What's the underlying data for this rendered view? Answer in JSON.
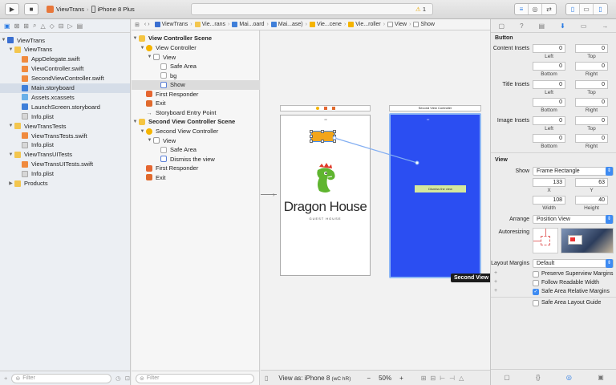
{
  "toolbar": {
    "scheme_target": "ViewTrans",
    "device": "iPhone 8 Plus",
    "warning_count": "1"
  },
  "navigator": {
    "filter_placeholder": "Filter",
    "items": [
      {
        "label": "ViewTrans",
        "type": "project",
        "level": 0
      },
      {
        "label": "ViewTrans",
        "type": "folder",
        "level": 1
      },
      {
        "label": "AppDelegate.swift",
        "type": "swift",
        "level": 2
      },
      {
        "label": "ViewController.swift",
        "type": "swift",
        "level": 2
      },
      {
        "label": "SecondViewController.swift",
        "type": "swift",
        "level": 2
      },
      {
        "label": "Main.storyboard",
        "type": "storyboard",
        "level": 2
      },
      {
        "label": "Assets.xcassets",
        "type": "assets",
        "level": 2
      },
      {
        "label": "LaunchScreen.storyboard",
        "type": "storyboard",
        "level": 2
      },
      {
        "label": "Info.plist",
        "type": "plist",
        "level": 2
      },
      {
        "label": "ViewTransTests",
        "type": "folder",
        "level": 1
      },
      {
        "label": "ViewTransTests.swift",
        "type": "swift",
        "level": 2
      },
      {
        "label": "Info.plist",
        "type": "plist",
        "level": 2
      },
      {
        "label": "ViewTransUITests",
        "type": "folder",
        "level": 1
      },
      {
        "label": "ViewTransUITests.swift",
        "type": "swift",
        "level": 2
      },
      {
        "label": "Info.plist",
        "type": "plist",
        "level": 2
      },
      {
        "label": "Products",
        "type": "folder",
        "level": 1
      }
    ]
  },
  "jumpbar": {
    "crumbs": [
      "ViewTrans",
      "Vie...rans",
      "Mai...oard",
      "Mai...ase)",
      "Vie...cene",
      "Vie...roller",
      "View",
      "Show"
    ]
  },
  "outline": {
    "filter_placeholder": "Filter",
    "scene1": {
      "title": "View Controller Scene",
      "controller": "View Controller",
      "view": "View",
      "safe_area": "Safe Area",
      "bg": "bg",
      "show": "Show",
      "first_responder": "First Responder",
      "exit": "Exit",
      "entry": "Storyboard Entry Point"
    },
    "scene2": {
      "title": "Second View Controller Scene",
      "controller": "Second View Controller",
      "view": "View",
      "safe_area": "Safe Area",
      "dismiss": "Dismiss the view",
      "first_responder": "First Responder",
      "exit": "Exit"
    }
  },
  "canvas": {
    "second_scene_header": "Second View Controller",
    "dismiss_button": "Dismiss the view",
    "logo_title": "Dragon House",
    "logo_subtitle": "GUEST HOUSE",
    "tooltip": "Second View C",
    "second_bg_color": "#2b4ef2",
    "selection_color": "#f2a51a"
  },
  "bottombar": {
    "view_as": "View as: iPhone 8",
    "view_as_suffix": "(wC hR)",
    "zoom": "50%"
  },
  "inspector": {
    "section_button": "Button",
    "content_insets": "Content Insets",
    "title_insets": "Title Insets",
    "image_insets": "Image Insets",
    "left": "Left",
    "top": "Top",
    "bottom": "Bottom",
    "right": "Right",
    "zero": "0",
    "section_view": "View",
    "show_label": "Show",
    "show_value": "Frame Rectangle",
    "x_value": "133",
    "y_value": "63",
    "x_label": "X",
    "y_label": "Y",
    "width_value": "108",
    "height_value": "40",
    "width_label": "Width",
    "height_label": "Height",
    "arrange_label": "Arrange",
    "arrange_value": "Position View",
    "autoresizing_label": "Autoresizing",
    "layout_margins_label": "Layout Margins",
    "layout_margins_value": "Default",
    "preserve_superview": "Preserve Superview Margins",
    "follow_readable": "Follow Readable Width",
    "safe_area_relative": "Safe Area Relative Margins",
    "safe_area_guide": "Safe Area Layout Guide"
  }
}
